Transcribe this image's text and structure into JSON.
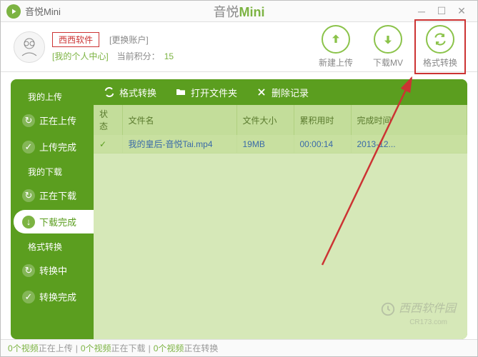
{
  "title": {
    "prefix": "音悦",
    "suffix": "Mini",
    "center_cn": "音悦",
    "center_en": "Mini"
  },
  "header": {
    "brandbox": "西西软件",
    "switch_account": "[更换账户]",
    "personal_center": "[我的个人中心]",
    "points_label": "当前积分：",
    "points_value": "15"
  },
  "actions": {
    "upload": "新建上传",
    "download": "下载MV",
    "convert": "格式转换"
  },
  "sidebar": {
    "group_upload": "我的上传",
    "uploading": "正在上传",
    "upload_done": "上传完成",
    "group_download": "我的下载",
    "downloading": "正在下载",
    "download_done": "下载完成",
    "group_convert": "格式转换",
    "converting": "转换中",
    "convert_done": "转换完成"
  },
  "toolbar": {
    "convert": "格式转换",
    "openfolder": "打开文件夹",
    "delrecord": "删除记录"
  },
  "table": {
    "headers": {
      "status": "状态",
      "filename": "文件名",
      "filesize": "文件大小",
      "elapsed": "累积用时",
      "finishtime": "完成时间"
    },
    "rows": [
      {
        "status_icon": "✓",
        "filename": "我的皇后-音悦Tai.mp4",
        "filesize": "19MB",
        "elapsed": "00:00:14",
        "finishtime": "2013-12..."
      }
    ]
  },
  "statusbar": {
    "s1_num": "0",
    "s1_unit": "个视频",
    "s1_rest": "正在上传",
    "s2_num": "0",
    "s2_unit": "个视频",
    "s2_rest": "正在下载",
    "s3_num": "0",
    "s3_unit": "个视频",
    "s3_rest": "正在转换"
  },
  "watermark": {
    "main": "西西软件园",
    "sub": "CR173.com"
  },
  "annotation": {
    "highlight_target": "convert-action"
  }
}
